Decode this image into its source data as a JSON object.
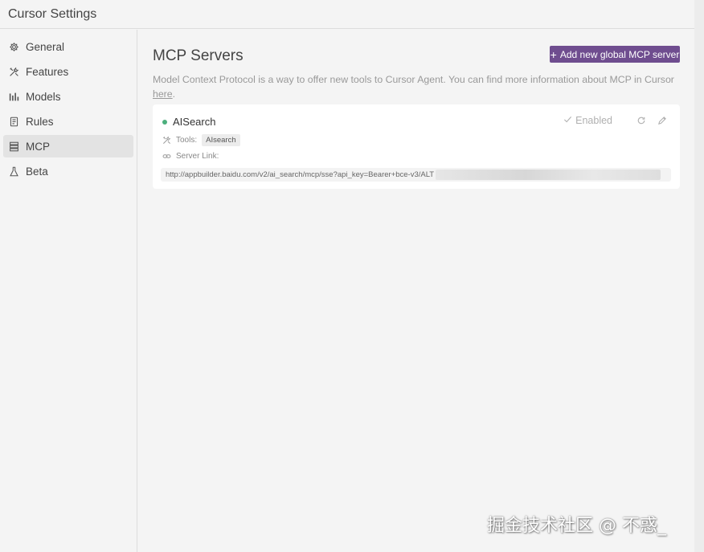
{
  "window": {
    "title": "Cursor Settings"
  },
  "sidebar": {
    "items": [
      {
        "label": "General",
        "icon": "gear-icon",
        "active": false
      },
      {
        "label": "Features",
        "icon": "tools-icon",
        "active": false
      },
      {
        "label": "Models",
        "icon": "bar-chart-icon",
        "active": false
      },
      {
        "label": "Rules",
        "icon": "document-icon",
        "active": false
      },
      {
        "label": "MCP",
        "icon": "server-icon",
        "active": true
      },
      {
        "label": "Beta",
        "icon": "flask-icon",
        "active": false
      }
    ]
  },
  "main": {
    "title": "MCP Servers",
    "add_button_label": "Add new global MCP server",
    "description": "Model Context Protocol is a way to offer new tools to Cursor Agent. You can find more information about MCP in Cursor ",
    "description_link": "here",
    "description_end": "."
  },
  "server": {
    "name": "AISearch",
    "status_color": "#4caf7d",
    "enabled_label": "Enabled",
    "tools_label": "Tools:",
    "tool_tag": "AIsearch",
    "server_link_label": "Server Link:",
    "url": "http://appbuilder.baidu.com/v2/ai_search/mcp/sse?api_key=Bearer+bce-v3/ALT"
  },
  "colors": {
    "accent": "#6f4d8f"
  },
  "watermark": "掘金技术社区 @ 不惑_"
}
